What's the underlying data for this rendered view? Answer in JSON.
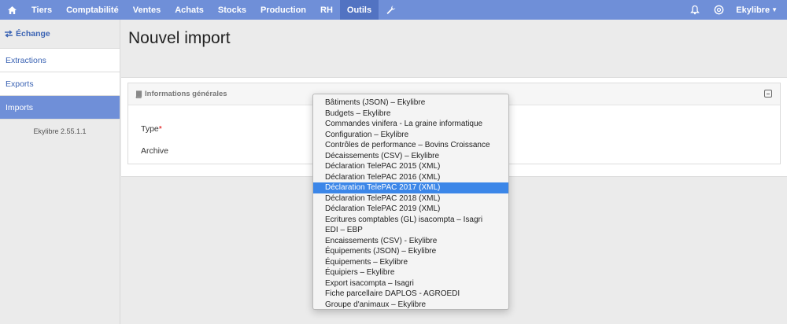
{
  "topbar": {
    "items": [
      {
        "label": "Tiers",
        "active": false
      },
      {
        "label": "Comptabilité",
        "active": false
      },
      {
        "label": "Ventes",
        "active": false
      },
      {
        "label": "Achats",
        "active": false
      },
      {
        "label": "Stocks",
        "active": false
      },
      {
        "label": "Production",
        "active": false
      },
      {
        "label": "RH",
        "active": false
      },
      {
        "label": "Outils",
        "active": true
      }
    ],
    "user_label": "Ekylibre"
  },
  "sidebar": {
    "heading": "Échange",
    "items": [
      {
        "label": "Extractions",
        "active": false
      },
      {
        "label": "Exports",
        "active": false
      },
      {
        "label": "Imports",
        "active": true
      }
    ],
    "version": "Ekylibre 2.55.1.1"
  },
  "main": {
    "title": "Nouvel import",
    "panel_title": "Informations générales",
    "type_label": "Type",
    "required_mark": "*",
    "archive_label": "Archive"
  },
  "dropdown": {
    "options": [
      "Bâtiments (JSON) – Ekylibre",
      "Budgets – Ekylibre",
      "Commandes vinifera - La graine informatique",
      "Configuration – Ekylibre",
      "Contrôles de performance – Bovins Croissance",
      "Décaissements (CSV) – Ekylibre",
      "Déclaration TelePAC 2015 (XML)",
      "Déclaration TelePAC 2016 (XML)",
      "Déclaration TelePAC 2017 (XML)",
      "Déclaration TelePAC 2018 (XML)",
      "Déclaration TelePAC 2019 (XML)",
      "Ecritures comptables (GL) isacompta – Isagri",
      "EDI – EBP",
      "Encaissements (CSV) - Ekylibre",
      "Équipements (JSON) – Ekylibre",
      "Équipements – Ekylibre",
      "Équipiers – Ekylibre",
      "Export isacompta – Isagri",
      "Fiche parcellaire DAPLOS - AGROEDI",
      "Groupe d'animaux – Ekylibre"
    ],
    "selected_index": 8
  },
  "colors": {
    "nav_bg": "#6f8fd8",
    "nav_active": "#5273c2",
    "link": "#3c64b4",
    "selection": "#3b86e8"
  }
}
